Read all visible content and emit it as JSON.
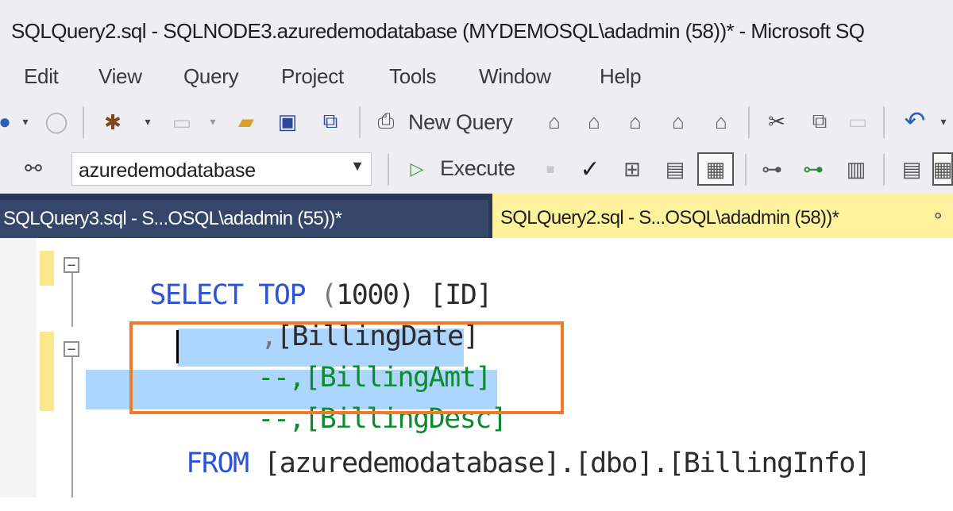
{
  "window": {
    "title": "SQLQuery2.sql - SQLNODE3.azuredemodatabase (MYDEMOSQL\\adadmin (58))* - Microsoft SQ"
  },
  "menu": {
    "items": [
      "Edit",
      "View",
      "Query",
      "Project",
      "Tools",
      "Window",
      "Help"
    ]
  },
  "toolbar": {
    "new_query_label": "New Query",
    "execute_label": "Execute",
    "database_select": "azuredemodatabase"
  },
  "tabs": [
    {
      "label": "SQLQuery3.sql - S...OSQL\\adadmin (55))*",
      "active": false
    },
    {
      "label": "SQLQuery2.sql - S...OSQL\\adadmin (58))*",
      "active": true
    }
  ],
  "editor": {
    "lines": [
      {
        "parts": [
          "SELECT",
          " TOP ",
          "(",
          "1000",
          ") [ID]"
        ]
      },
      {
        "parts": [
          ",",
          "[BillingDate]"
        ]
      },
      {
        "parts": [
          "--,[BillingAmt]"
        ]
      },
      {
        "parts": [
          "--,[BillingDesc]"
        ]
      },
      {
        "parts": [
          "FROM",
          " [azuredemodatabase].[dbo].[BillingInfo]"
        ]
      }
    ]
  },
  "colors": {
    "keyword": "#2a54d4",
    "comment": "#0f8a2e",
    "selection": "#add6ff",
    "highlight_border": "#f07a2a",
    "active_tab": "#fff29d",
    "tabstrip": "#293955"
  }
}
